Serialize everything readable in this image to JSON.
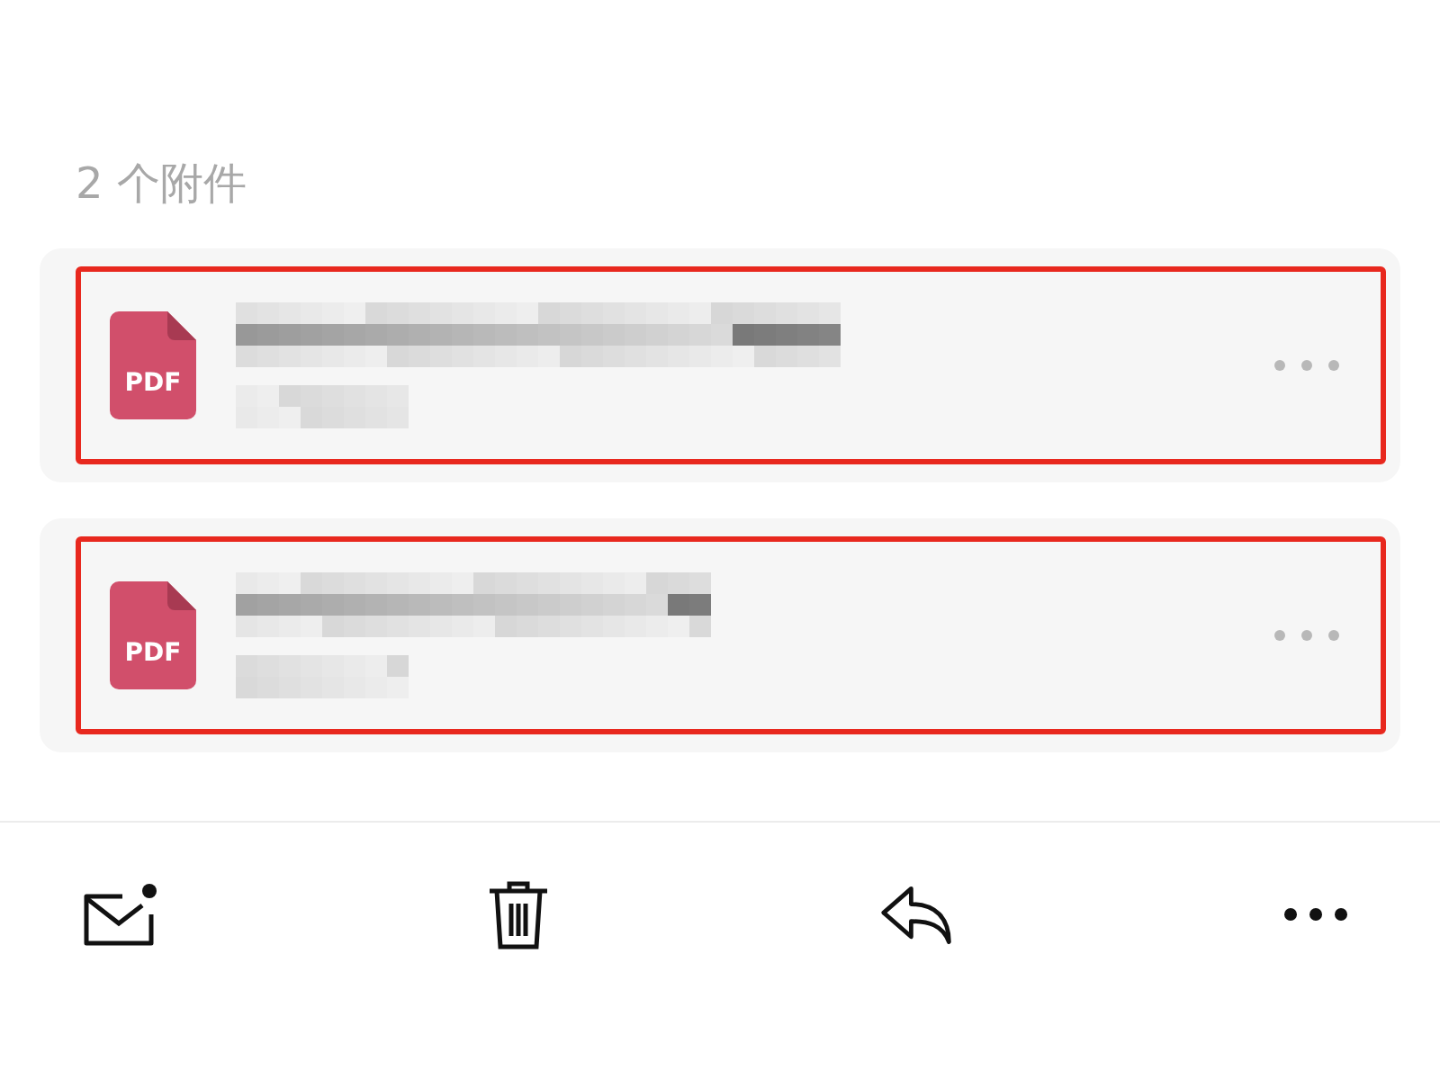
{
  "attachments_header": "2 个附件",
  "attachments": [
    {
      "file_type": "PDF",
      "annotated": true
    },
    {
      "file_type": "PDF",
      "annotated": true
    }
  ]
}
